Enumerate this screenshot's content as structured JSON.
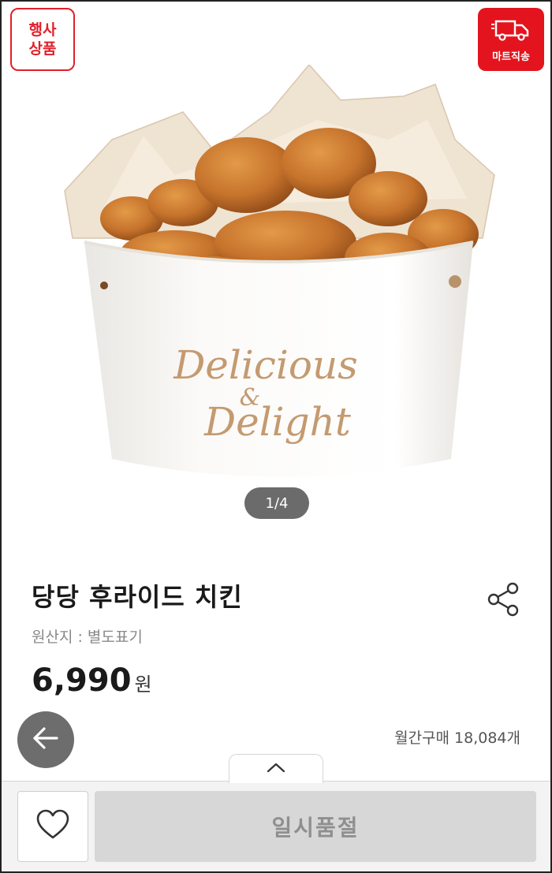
{
  "badges": {
    "event_line1": "행사",
    "event_line2": "상품",
    "delivery": "마트직송",
    "event_color": "#e0202a",
    "delivery_color": "#e3141e"
  },
  "product_image": {
    "cup_text_line1": "Delicious",
    "cup_text_line2": "&",
    "cup_text_line3": "Delight",
    "pager": "1/4"
  },
  "product": {
    "title": "당당 후라이드 치킨",
    "origin": "원산지 : 별도표기",
    "price": "6,990",
    "currency": "원",
    "monthly_purchases": "월간구매 18,084개"
  },
  "bottom_bar": {
    "soldout_label": "일시품절"
  },
  "icons": [
    "truck-icon",
    "share-icon",
    "back-arrow-icon",
    "chevron-up-icon",
    "heart-icon"
  ]
}
